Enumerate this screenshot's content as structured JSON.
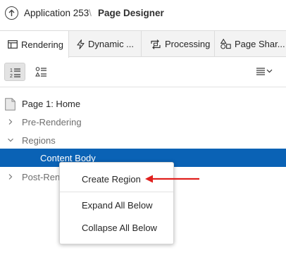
{
  "header": {
    "app": "Application 253",
    "separator": "\\",
    "page": "Page Designer"
  },
  "tabs": [
    {
      "label": "Rendering",
      "icon": "rendering-icon",
      "active": true
    },
    {
      "label": "Dynamic ...",
      "icon": "lightning-icon",
      "active": false
    },
    {
      "label": "Processing",
      "icon": "processing-icon",
      "active": false
    },
    {
      "label": "Page Shar...",
      "icon": "shapes-icon",
      "active": false
    }
  ],
  "toolbar": {
    "view_by_region": "numbered-list-icon",
    "view_by_component": "component-list-icon",
    "menu": "menu-icon"
  },
  "tree": [
    {
      "label": "Page 1: Home"
    },
    {
      "label": "Pre-Rendering"
    },
    {
      "label": "Regions"
    },
    {
      "label": "Content Body"
    },
    {
      "label": "Post-Rend"
    }
  ],
  "context_menu": {
    "items": [
      "Create Region",
      "Expand All Below",
      "Collapse All Below"
    ]
  },
  "colors": {
    "selection": "#0a62b5",
    "arrow": "#e0201e"
  }
}
